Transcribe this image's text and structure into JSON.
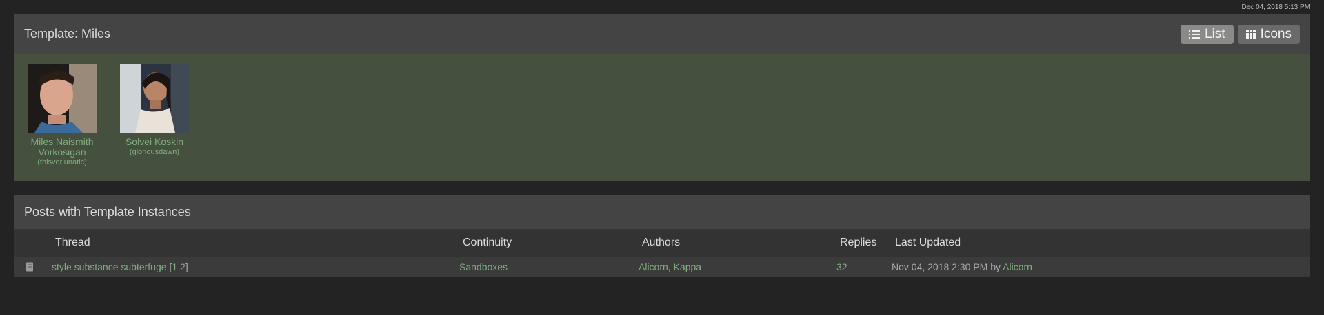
{
  "timestamp": "Dec 04, 2018 5:13 PM",
  "template_panel": {
    "title": "Template: Miles",
    "buttons": {
      "list": "List",
      "icons": "Icons"
    },
    "characters": [
      {
        "name": "Miles Naismith Vorkosigan",
        "user": "(thisvorlunatic)"
      },
      {
        "name": "Solvei Koskin",
        "user": "(gloriousdawn)"
      }
    ]
  },
  "posts_panel": {
    "title": "Posts with Template Instances",
    "columns": {
      "thread": "Thread",
      "continuity": "Continuity",
      "authors": "Authors",
      "replies": "Replies",
      "last_updated": "Last Updated"
    },
    "rows": [
      {
        "thread": "style substance subterfuge",
        "pages_open": "[",
        "page1": "1",
        "page2": "2",
        "pages_close": "]",
        "continuity": "Sandboxes",
        "author1": "Alicorn",
        "author_sep": ",",
        "author2": "Kappa",
        "replies": "32",
        "updated": "Nov 04, 2018 2:30 PM",
        "updated_by_label": "by",
        "updated_by": "Alicorn"
      }
    ]
  },
  "colors": {
    "background": "#232323",
    "header": "#444444",
    "gallery": "#46503f",
    "link": "#7fae7f"
  },
  "icons": [
    "list-icon",
    "grid-icon",
    "thread-icon"
  ]
}
